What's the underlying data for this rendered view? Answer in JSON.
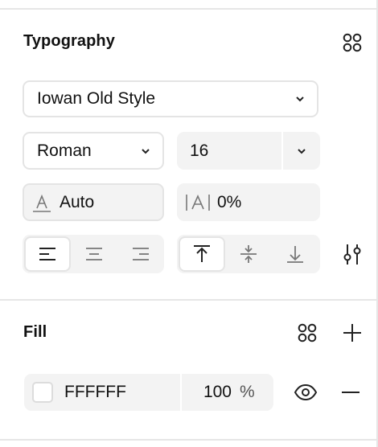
{
  "typography": {
    "title": "Typography",
    "font_family": "Iowan Old Style",
    "font_style": "Roman",
    "font_size": "16",
    "line_height": "Auto",
    "letter_spacing": "0%"
  },
  "fill": {
    "title": "Fill",
    "hex": "FFFFFF",
    "opacity": "100",
    "opacity_unit": "%"
  },
  "colors": {
    "swatch": "#FFFFFF",
    "field_bg": "#F3F3F3",
    "border": "#E4E4E4"
  },
  "icons": [
    "styles-grid-icon",
    "chevron-down-icon",
    "line-height-icon",
    "letter-spacing-icon",
    "align-left-icon",
    "align-center-icon",
    "align-right-icon",
    "align-top-icon",
    "align-middle-icon",
    "align-bottom-icon",
    "type-settings-icon",
    "plus-icon",
    "eye-icon",
    "minus-icon"
  ]
}
